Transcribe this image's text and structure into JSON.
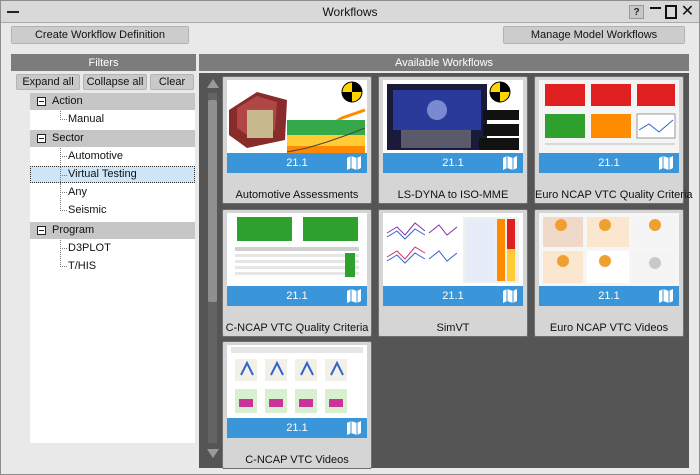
{
  "window": {
    "title": "Workflows",
    "help_label": "?",
    "close_label": "✕"
  },
  "toolbar": {
    "create_label": "Create Workflow Definition",
    "manage_label": "Manage Model Workflows"
  },
  "filters": {
    "header": "Filters",
    "expand_label": "Expand all",
    "collapse_label": "Collapse all",
    "clear_label": "Clear",
    "groups": [
      {
        "label": "Action",
        "items": [
          "Manual"
        ]
      },
      {
        "label": "Sector",
        "items": [
          "Automotive",
          "Virtual Testing",
          "Any",
          "Seismic"
        ]
      },
      {
        "label": "Program",
        "items": [
          "D3PLOT",
          "T/HIS"
        ]
      }
    ],
    "selected_item": "Virtual Testing"
  },
  "workflows": {
    "header": "Available Workflows",
    "cards": [
      {
        "name": "Automotive Assessments",
        "version": "21.1",
        "thumb": "car-crash-image"
      },
      {
        "name": "LS-DYNA to ISO-MME",
        "version": "21.1",
        "thumb": "car-body-image"
      },
      {
        "name": "Euro NCAP VTC Quality Criteria",
        "version": "21.1",
        "thumb": "quality-grid-image"
      },
      {
        "name": "C-NCAP VTC Quality Criteria",
        "version": "21.1",
        "thumb": "quality-table-image"
      },
      {
        "name": "SimVT",
        "version": "21.1",
        "thumb": "plots-table-image"
      },
      {
        "name": "Euro NCAP VTC Videos",
        "version": "21.1",
        "thumb": "dummy-videos-image"
      },
      {
        "name": "C-NCAP VTC Videos",
        "version": "21.1",
        "thumb": "sled-videos-image"
      }
    ]
  },
  "colors": {
    "accent_blue": "#3a96d8",
    "header_gray": "#7c7c7c",
    "selection": "#cfe6f8"
  }
}
